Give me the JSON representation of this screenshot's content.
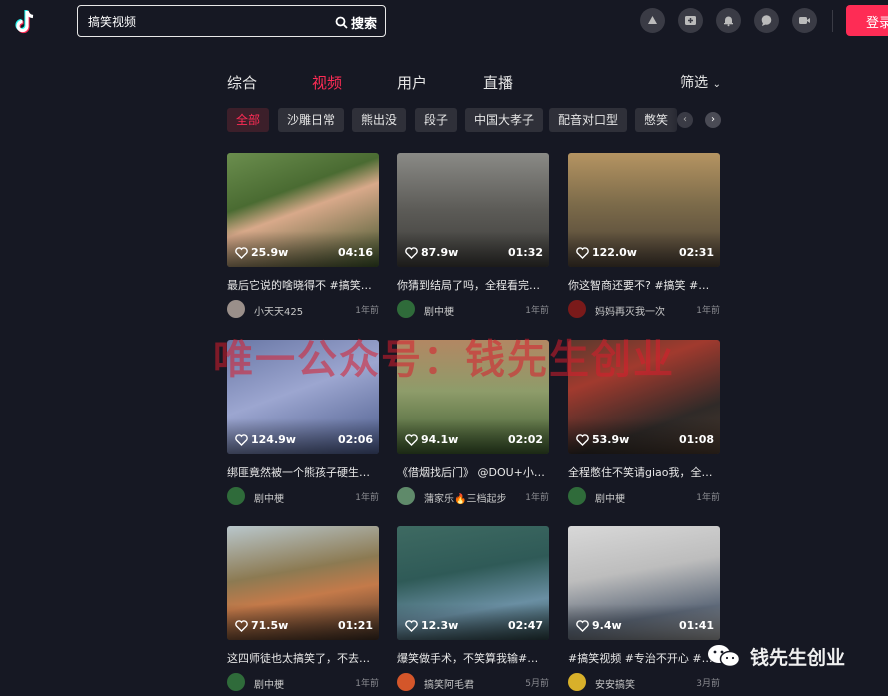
{
  "search": {
    "query": "搞笑视频",
    "button_label": "搜索"
  },
  "header": {
    "login_label": "登录"
  },
  "tabs": [
    "综合",
    "视频",
    "用户",
    "直播"
  ],
  "filter_label": "筛选",
  "chips": [
    "全部",
    "沙雕日常",
    "熊出没",
    "段子",
    "中国大孝子",
    "配音对口型",
    "憋笑"
  ],
  "cards": [
    {
      "likes": "25.9w",
      "duration": "04:16",
      "caption": "最后它说的啥晓得不 #搞笑视频",
      "author": "小天天425",
      "time": "1年前"
    },
    {
      "likes": "87.9w",
      "duration": "01:32",
      "caption": "你猜到结局了吗，全程看完…",
      "author": "剧中梗",
      "time": "1年前"
    },
    {
      "likes": "122.0w",
      "duration": "02:31",
      "caption": "你这智商还要不?  #搞笑 #戏精",
      "author": "妈妈再灭我一次",
      "time": "1年前"
    },
    {
      "likes": "124.9w",
      "duration": "02:06",
      "caption": "绑匪竟然被一个熊孩子硬生…",
      "author": "剧中梗",
      "time": "1年前"
    },
    {
      "likes": "94.1w",
      "duration": "02:02",
      "caption": "《借烟找后门》 @DOU+小…",
      "author": "蒲家乐🔥三档起步",
      "time": "1年前"
    },
    {
      "likes": "53.9w",
      "duration": "01:08",
      "caption": "全程憋住不笑请giao我，全…",
      "author": "剧中梗",
      "time": "1年前"
    },
    {
      "likes": "71.5w",
      "duration": "01:21",
      "caption": "这四师徒也太搞笑了，不去…",
      "author": "剧中梗",
      "time": "1年前"
    },
    {
      "likes": "12.3w",
      "duration": "02:47",
      "caption": "爆笑做手术，不笑算我输#…",
      "author": "搞笑阿毛君",
      "time": "5月前"
    },
    {
      "likes": "9.4w",
      "duration": "01:41",
      "caption": "#搞笑视频 #专治不开心 #一…",
      "author": "安安搞笑",
      "time": "3月前"
    }
  ],
  "watermark": "唯一公众号：钱先生创业",
  "brand": "钱先生创业"
}
